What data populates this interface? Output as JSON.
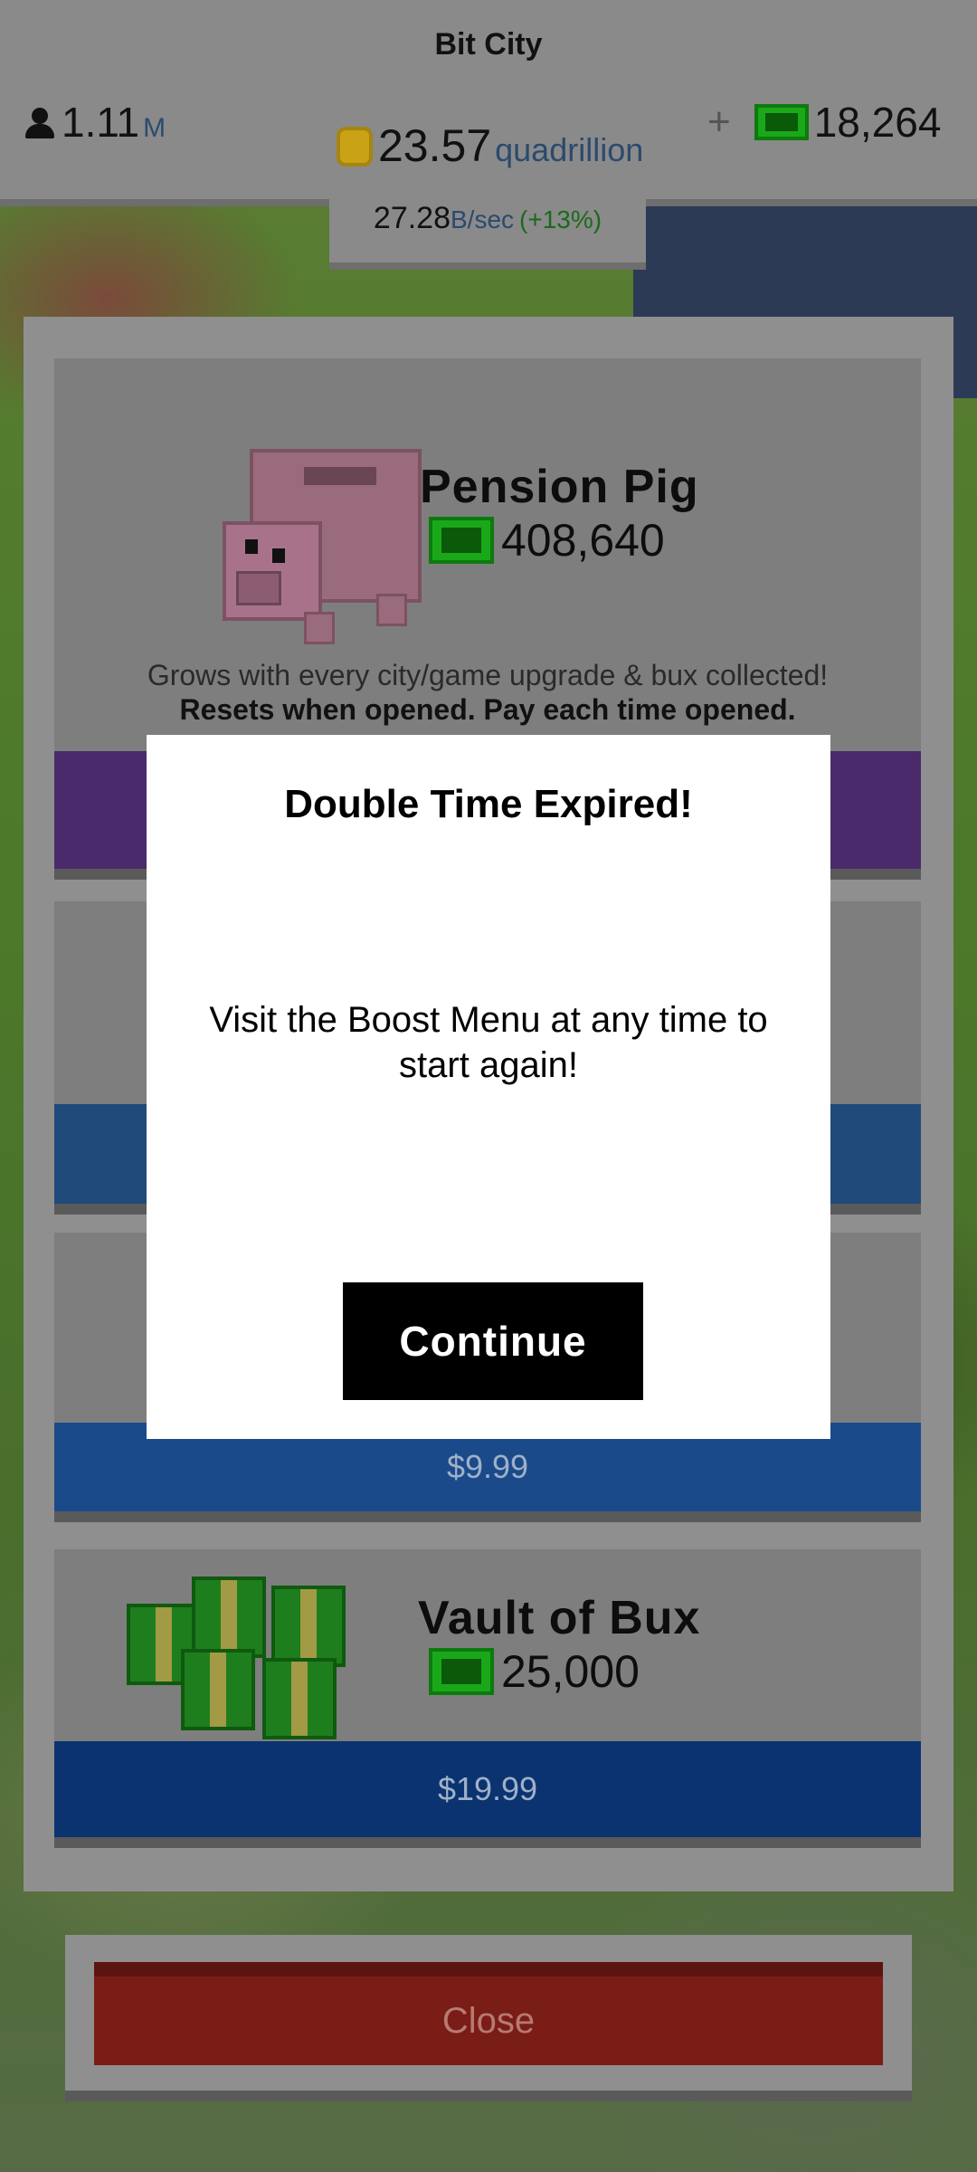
{
  "header": {
    "title": "Bit City",
    "population": {
      "value": "1.11",
      "unit": "M"
    },
    "coins": {
      "value": "23.57",
      "unit": "quadrillion"
    },
    "bux": {
      "plus": "+",
      "value": "18,264"
    },
    "rate": {
      "value": "27.28",
      "unit": "B/sec",
      "bonus": "(+13%)"
    }
  },
  "shop": {
    "pension_pig": {
      "title": "Pension Pig",
      "amount": "408,640",
      "desc_line1": "Grows with every city/game upgrade & bux collected!",
      "desc_line2": "Resets when opened. Pay each time opened."
    },
    "third_item": {
      "price": "$9.99"
    },
    "vault_of_bux": {
      "title": "Vault of Bux",
      "amount": "25,000",
      "price": "$19.99"
    }
  },
  "close_label": "Close",
  "modal": {
    "title": "Double Time Expired!",
    "message": "Visit the Boost Menu at any time to start again!",
    "continue_label": "Continue"
  },
  "colors": {
    "overlay": "#8a8a8a",
    "bux_green": "#1aa81a",
    "purchase_blue": "#0a3a7a",
    "close_red": "#7a1d16"
  },
  "icons": [
    "person-icon",
    "coin-icon",
    "plus-icon",
    "bill-icon",
    "piggy-bank-icon",
    "money-stack-icon"
  ]
}
